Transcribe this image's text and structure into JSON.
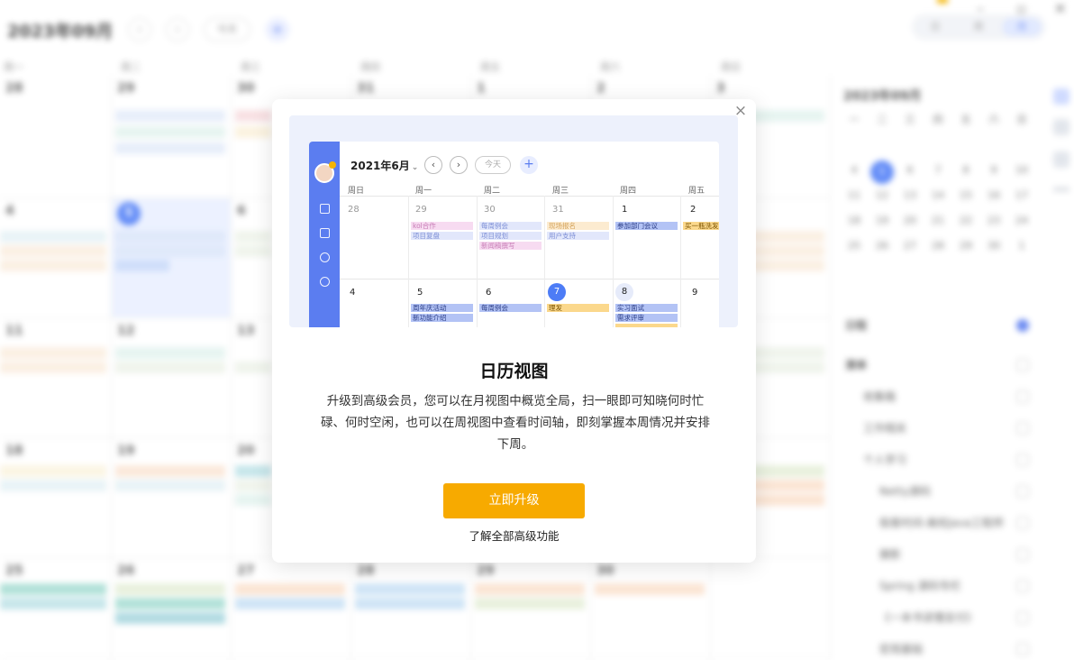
{
  "background": {
    "month_title": "2023年09月",
    "today_btn": "今天",
    "weekdays": [
      "周一",
      "周二",
      "周三",
      "周四",
      "周五",
      "周六",
      "周日"
    ],
    "view_labels": [
      "日",
      "周",
      "月"
    ],
    "mini_title": "2023年09月",
    "side_heading": "日程",
    "list_heading": "清单",
    "list_items": [
      "收集箱",
      "工作相关",
      "个人学习",
      "Netty源码",
      "极客时间-离校Java工程师",
      "摄影",
      "Spring 源码专栏",
      "《一本书读懂支付》",
      "宏观基础"
    ]
  },
  "modal": {
    "title": "日历视图",
    "description": "升级到高级会员，您可以在月视图中概览全局，扫一眼即可知晓何时忙碌、何时空闲，也可以在周视图中查看时间轴，即刻掌握本周情况并安排下周。",
    "upgrade_button": "立即升级",
    "learn_more_link": "了解全部高级功能",
    "close_label": "×",
    "preview": {
      "month_title": "2021年6月",
      "month_chevron": "⌄",
      "prev": "‹",
      "next": "›",
      "today": "今天",
      "add": "+",
      "weekdays": [
        "周日",
        "周一",
        "周二",
        "周三",
        "周四",
        "周五"
      ],
      "week1": [
        "28",
        "29",
        "30",
        "31",
        "1",
        "2"
      ],
      "week2": [
        "4",
        "5",
        "6",
        "7",
        "8",
        "9"
      ],
      "events": {
        "mon1": [
          "kol合作",
          "项目复盘"
        ],
        "tue1": [
          "每周例会",
          "项目规划",
          "新闻稿撰写"
        ],
        "wed1": [
          "现场报名",
          "用户支持"
        ],
        "thu1": [
          "参加部门会议"
        ],
        "fri1": [
          "买一瓶洗发水"
        ],
        "mon2": [
          "周年庆活动",
          "新功能介绍"
        ],
        "tue2": [
          "每周例会"
        ],
        "wed2": [
          "理发"
        ],
        "thu2": [
          "实习面试",
          "需求评审"
        ]
      }
    }
  }
}
